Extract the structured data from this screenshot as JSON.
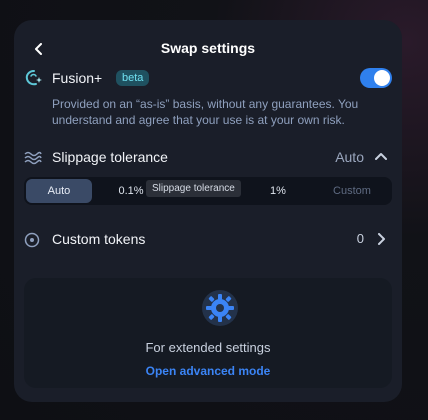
{
  "header": {
    "title": "Swap settings"
  },
  "fusion": {
    "label": "Fusion+",
    "badge": "beta",
    "enabled": true,
    "description": "Provided on an “as-is” basis, without any guarantees. You understand and agree that your use is at your own risk."
  },
  "slippage": {
    "label": "Slippage tolerance",
    "value": "Auto",
    "options": {
      "auto": "Auto",
      "low": "0.1%",
      "high": "1%",
      "custom": "Custom"
    },
    "tooltip": "Slippage tolerance"
  },
  "custom_tokens": {
    "label": "Custom tokens",
    "count": "0"
  },
  "advanced": {
    "text": "For extended settings",
    "link": "Open advanced mode"
  },
  "colors": {
    "accent": "#2f80ed",
    "link": "#3b84f5",
    "beta_bg": "#1f5160",
    "beta_text": "#6fe0f0"
  },
  "icons": {
    "back": "chevron-left-icon",
    "fusion": "fusion-sparkle-icon",
    "slippage": "waves-icon",
    "slippage_toggle": "chevron-up-icon",
    "tokens": "circle-dot-icon",
    "tokens_nav": "chevron-right-icon",
    "advanced": "gear-icon"
  }
}
